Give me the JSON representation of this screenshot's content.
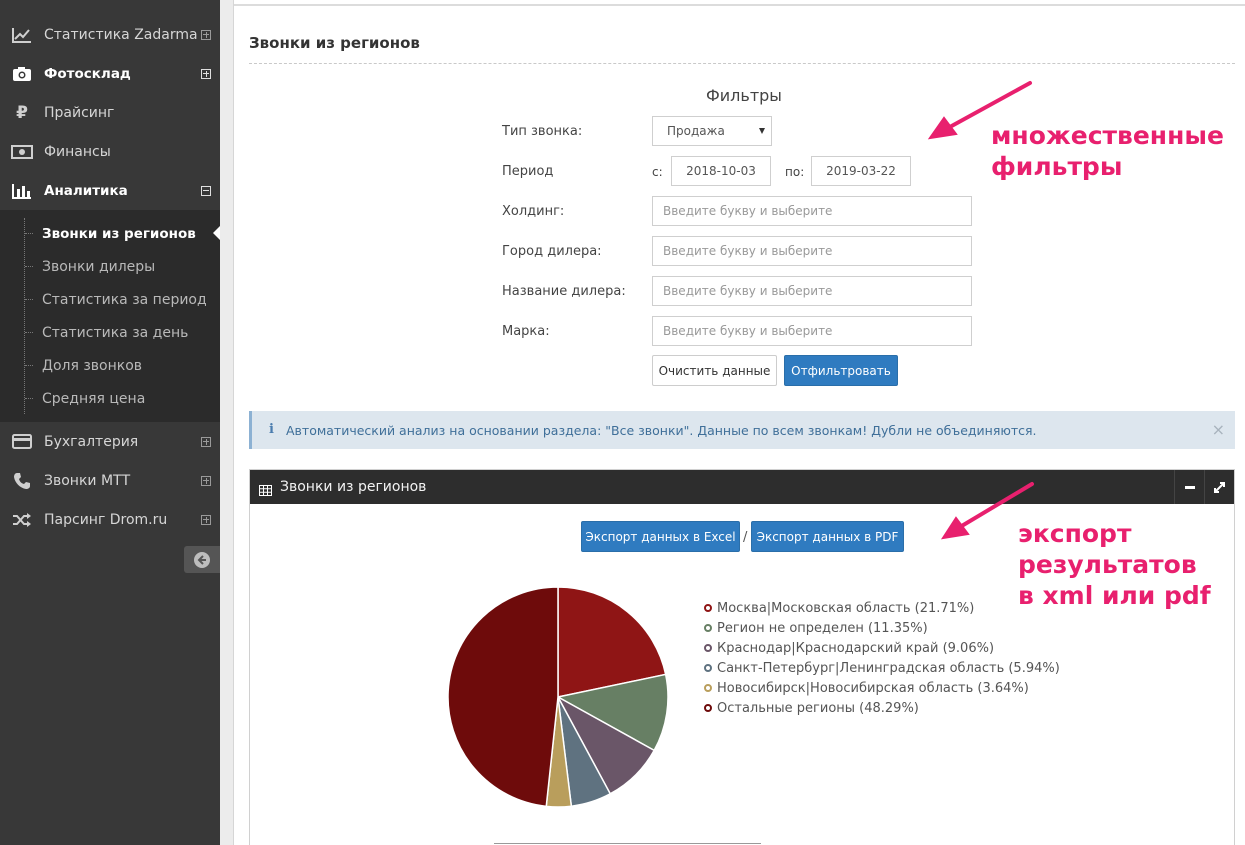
{
  "sidebar": {
    "items": [
      {
        "label": "Статистика Zadarma",
        "icon": "line-chart-icon",
        "toggle": "plus",
        "bold": false
      },
      {
        "label": "Фотосклад",
        "icon": "camera-icon",
        "toggle": "plus",
        "bold": true
      },
      {
        "label": "Прайсинг",
        "icon": "ruble-icon",
        "toggle": "none",
        "bold": false
      },
      {
        "label": "Финансы",
        "icon": "money-icon",
        "toggle": "none",
        "bold": false
      },
      {
        "label": "Аналитика",
        "icon": "bar-chart-icon",
        "toggle": "minus",
        "bold": true
      }
    ],
    "submenu": [
      {
        "label": "Звонки из регионов",
        "active": true
      },
      {
        "label": "Звонки дилеры",
        "active": false
      },
      {
        "label": "Статистика за период",
        "active": false
      },
      {
        "label": "Статистика за день",
        "active": false
      },
      {
        "label": "Доля звонков",
        "active": false
      },
      {
        "label": "Средняя цена",
        "active": false
      }
    ],
    "items_after": [
      {
        "label": "Бухгалтерия",
        "icon": "credit-card-icon",
        "toggle": "plus"
      },
      {
        "label": "Звонки МТТ",
        "icon": "phone-icon",
        "toggle": "plus"
      },
      {
        "label": "Парсинг Drom.ru",
        "icon": "shuffle-icon",
        "toggle": "plus"
      }
    ]
  },
  "page": {
    "title": "Звонки из регионов"
  },
  "filters": {
    "heading": "Фильтры",
    "call_type_label": "Тип звонка:",
    "call_type_value": "Продажа",
    "period_label": "Период",
    "from_label": "с:",
    "from_value": "2018-10-03",
    "to_label": "по:",
    "to_value": "2019-03-22",
    "holding_label": "Холдинг:",
    "dealer_city_label": "Город дилера:",
    "dealer_name_label": "Название дилера:",
    "brand_label": "Марка:",
    "placeholder": "Введите букву и выберите",
    "clear_label": "Очистить данные",
    "filter_label": "Отфильтровать"
  },
  "info": {
    "text": "Автоматический анализ на основании раздела: \"Все звонки\". Данные по всем звонкам! Дубли не объединяются.",
    "close": "×"
  },
  "widget": {
    "title": "Звонки из регионов",
    "export_excel": "Экспорт данных в Excel",
    "separator": "/",
    "export_pdf": "Экспорт данных в PDF"
  },
  "annotations": {
    "filters": [
      "множественные",
      "фильтры"
    ],
    "export": [
      "экспорт",
      "результатов",
      "в xml или pdf"
    ],
    "color": "#e8206e"
  },
  "chart_data": {
    "type": "pie",
    "categories": [
      "Москва|Московская область (21.71%)",
      "Регион не определен (11.35%)",
      "Краснодар|Краснодарский край (9.06%)",
      "Санкт-Петербург|Ленинградская область (5.94%)",
      "Новосибирск|Новосибирская область (3.64%)",
      "Остальные регионы (48.29%)"
    ],
    "values": [
      21.71,
      11.35,
      9.06,
      5.94,
      3.64,
      48.29
    ],
    "colors": [
      "#8f1515",
      "#677f64",
      "#6a5668",
      "#5f7280",
      "#b99e5c",
      "#6e0b0b"
    ],
    "legend": "right"
  }
}
